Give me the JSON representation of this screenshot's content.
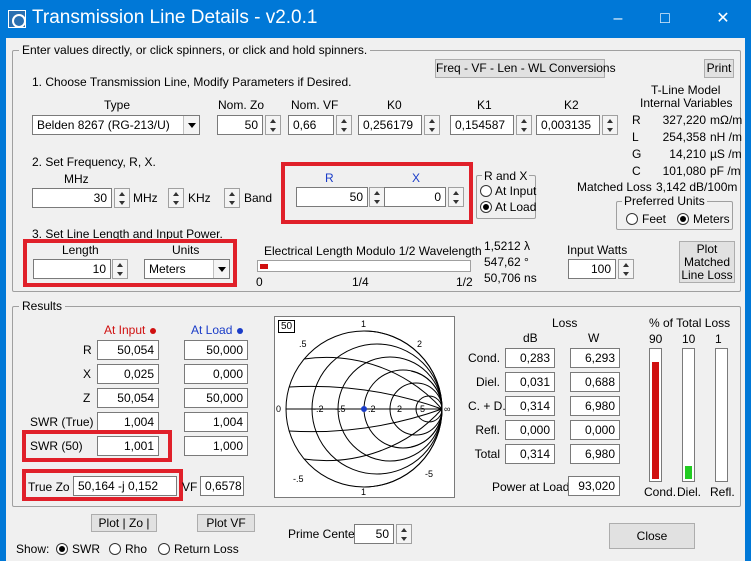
{
  "window": {
    "title": "Transmission Line Details - v2.0.1",
    "min": "–",
    "max": "□",
    "close": "✕"
  },
  "intro": "Enter values directly, or click spinners, or click and hold spinners.",
  "buttons": {
    "conversions": "Freq - VF - Len - WL Conversions",
    "print": "Print",
    "plot_loss": "Plot Matched Line Loss",
    "plot_zo": "Plot | Zo |",
    "plot_vf": "Plot VF",
    "close": "Close"
  },
  "section1": {
    "label": "1. Choose Transmission Line, Modify Parameters if Desired.",
    "type_label": "Type",
    "type_value": "Belden 8267   (RG-213/U)",
    "nom_zo_label": "Nom. Zo",
    "nom_zo": "50",
    "nom_vf_label": "Nom. VF",
    "nom_vf": "0,66",
    "k0_label": "K0",
    "k0": "0,256179",
    "k1_label": "K1",
    "k1": "0,154587",
    "k2_label": "K2",
    "k2": "0,003135"
  },
  "tmodel": {
    "title1": "T-Line Model",
    "title2": "Internal Variables",
    "rows": [
      {
        "k": "R",
        "v": "327,220",
        "u": "mΩ/m"
      },
      {
        "k": "L",
        "v": "254,358",
        "u": "nH /m"
      },
      {
        "k": "G",
        "v": "14,210",
        "u": "µS /m"
      },
      {
        "k": "C",
        "v": "101,080",
        "u": "pF /m"
      }
    ],
    "matched_loss_label": "Matched Loss",
    "matched_loss": "3,142 dB/100m"
  },
  "section2": {
    "label": "2. Set Frequency, R, X.",
    "mhz_label": "MHz",
    "freq": "30",
    "mhz": "MHz",
    "khz": "KHz",
    "band": "Band",
    "r_label": "R",
    "r_value": "50",
    "x_label": "X",
    "x_value": "0",
    "rx_group": "R and X",
    "at_input": "At Input",
    "at_load": "At Load"
  },
  "preferred": {
    "title": "Preferred Units",
    "feet": "Feet",
    "meters": "Meters"
  },
  "section3": {
    "label": "3. Set Line Length and Input Power.",
    "length_label": "Length",
    "length": "10",
    "units_label": "Units",
    "units": "Meters",
    "elec_label": "Electrical Length Modulo 1/2 Wavelength",
    "scale_0": "0",
    "scale_q": "1/4",
    "scale_h": "1/2",
    "elec_fraction": 0.03,
    "wl": "1,5212 λ",
    "deg": "547,62 °",
    "ns": "50,706 ns",
    "input_watts_label": "Input Watts",
    "input_watts": "100"
  },
  "results": {
    "title": "Results",
    "at_input": "At Input",
    "at_load": "At Load",
    "rows": [
      {
        "label": "R",
        "input": "50,054",
        "load": "50,000"
      },
      {
        "label": "X",
        "input": "0,025",
        "load": "0,000"
      },
      {
        "label": "Z",
        "input": "50,054",
        "load": "50,000"
      },
      {
        "label": "SWR (True)",
        "input": "1,004",
        "load": "1,004"
      },
      {
        "label": "SWR   (50)",
        "input": "1,001",
        "load": "1,000"
      }
    ],
    "true_zo_label": "True Zo",
    "true_zo": "50,164 -j 0,152",
    "vf_label": "VF",
    "vf": "0,6578",
    "smith_ref": "50"
  },
  "loss": {
    "title": "Loss",
    "db": "dB",
    "w": "W",
    "rows": [
      {
        "label": "Cond.",
        "db": "0,283",
        "w": "6,293"
      },
      {
        "label": "Diel.",
        "db": "0,031",
        "w": "0,688"
      },
      {
        "label": "C. + D.",
        "db": "0,314",
        "w": "6,980"
      },
      {
        "label": "Refl.",
        "db": "0,000",
        "w": "0,000"
      },
      {
        "label": "Total",
        "db": "0,314",
        "w": "6,980"
      }
    ],
    "power_load_label": "Power at Load",
    "power_load": "93,020"
  },
  "total_loss": {
    "title": "% of Total Loss",
    "scale": [
      "90",
      "10",
      "1"
    ],
    "bars": [
      {
        "label": "Cond.",
        "fraction": 0.9,
        "color": "#d01010"
      },
      {
        "label": "Diel.",
        "fraction": 0.1,
        "color": "#22cc22"
      },
      {
        "label": "Refl.",
        "fraction": 0.0,
        "color": "#1a3cc8"
      }
    ]
  },
  "show": {
    "label": "Show:",
    "swr": "SWR",
    "rho": "Rho",
    "return_loss": "Return Loss"
  },
  "prime": {
    "label": "Prime Center",
    "value": "50"
  },
  "smith_labels": {
    "l1": "1",
    "l5": ".5",
    "l2": "2",
    "l2n": "2",
    "l5n": ".5",
    "lm": "-.5",
    "ln": "-.2",
    "l0": "0",
    "l22": ".2",
    "inf": "∞",
    "l1n": "1",
    "l5b": "5",
    "l5c": "5",
    "m5": "-5",
    "m5b": "-.5"
  }
}
